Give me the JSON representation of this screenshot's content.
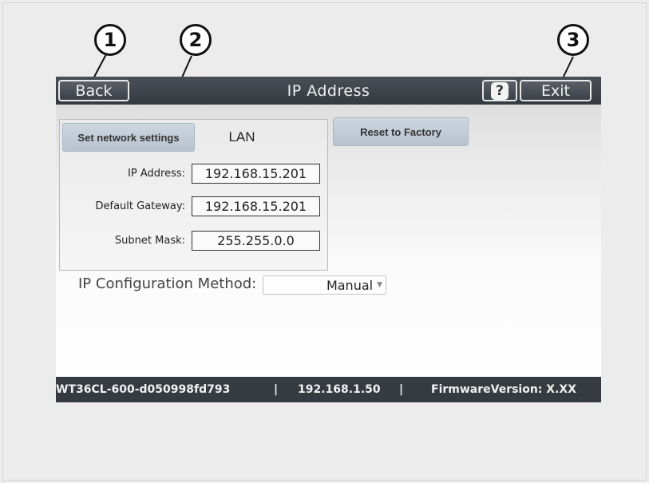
{
  "callouts": [
    "1",
    "2",
    "3"
  ],
  "titlebar": {
    "back_label": "Back",
    "title": "IP Address",
    "help_label": "?",
    "exit_label": "Exit"
  },
  "main": {
    "set_network_label": "Set network settings",
    "lan_label": "LAN",
    "reset_label": "Reset to Factory",
    "fields": [
      {
        "label": "IP Address:",
        "value": "192.168.15.201"
      },
      {
        "label": "Default Gateway:",
        "value": "192.168.15.201"
      },
      {
        "label": "Subnet Mask:",
        "value": "255.255.0.0"
      }
    ],
    "method_label": "IP Configuration Method:",
    "method_value": "Manual"
  },
  "status": {
    "device_name": "WT36CL-600-d050998fd793",
    "separator": "|",
    "ip": "192.168.1.50",
    "firmware": "FirmwareVersion: X.XX"
  },
  "colors": {
    "titlebar": "#3c4148",
    "statusbar": "#363a41",
    "button": "#c3ccd6"
  }
}
